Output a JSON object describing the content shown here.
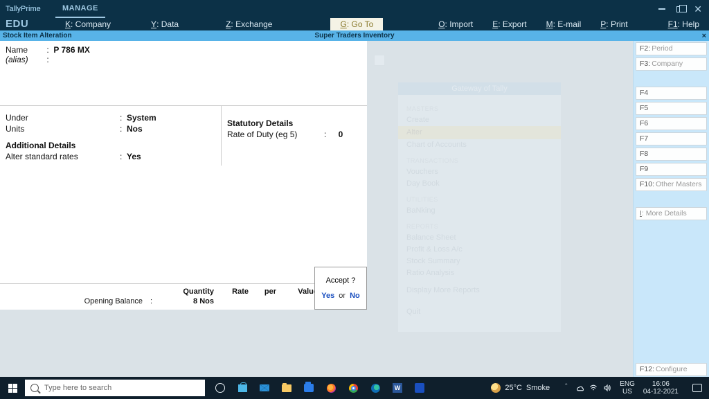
{
  "app": {
    "name": "TallyPrime",
    "edition": "EDU",
    "manage": "MANAGE"
  },
  "menu": {
    "company_key": "K",
    "company": ": Company",
    "data_key": "Y",
    "data": ": Data",
    "exchange_key": "Z",
    "exchange": ": Exchange",
    "goto_key": "G",
    "goto": ": Go To",
    "import_key": "O",
    "import": ": Import",
    "export_key": "E",
    "export": ": Export",
    "email_key": "M",
    "email": ": E-mail",
    "print_key": "P",
    "print": ": Print",
    "help_key": "F1",
    "help": ": Help"
  },
  "context": {
    "left": "Stock Item Alteration",
    "center": "Super Traders  Inventory"
  },
  "form": {
    "name_label": "Name",
    "name_value": "P 786 MX",
    "alias_label": "(alias)",
    "alias_value": "",
    "under_label": "Under",
    "under_value": "System",
    "units_label": "Units",
    "units_value": "Nos",
    "additional_title": "Additional Details",
    "alter_label": "Alter standard rates",
    "alter_value": "Yes",
    "statutory_title": "Statutory Details",
    "rate_label": "Rate of Duty (eg 5)",
    "rate_value": "0",
    "ob_header": {
      "qty": "Quantity",
      "rate": "Rate",
      "per": "per",
      "value": "Value"
    },
    "ob_label": "Opening Balance",
    "ob_qty": "8 Nos"
  },
  "accept": {
    "question": "Accept ?",
    "yes": "Yes",
    "or": "or",
    "no": "No"
  },
  "fkeys": {
    "f2k": "F2",
    "f2": "Period",
    "f3k": "F3",
    "f3": "Company",
    "f4": "F4",
    "f5": "F5",
    "f6": "F6",
    "f7": "F7",
    "f8": "F8",
    "f9": "F9",
    "f10k": "F10",
    "f10": "Other Masters",
    "morek": "I",
    "more": ": More Details",
    "f12k": "F12",
    "f12": "Configure"
  },
  "gateway": {
    "title": "Gateway of Tally",
    "cat_masters": "MASTERS",
    "create": "Create",
    "alter": "Alter",
    "coa": "Chart of Accounts",
    "cat_trans": "TRANSACTIONS",
    "vouch": "Vouchers",
    "daybook": "Day Book",
    "cat_util": "UTILITIES",
    "banking": "BaNking",
    "cat_rep": "REPORTS",
    "bs": "Balance Sheet",
    "pl": "Profit & Loss A/c",
    "ss": "Stock Summary",
    "ra": "Ratio Analysis",
    "dmr": "Display More Reports",
    "quit": "Quit"
  },
  "taskbar": {
    "search_placeholder": "Type here to search",
    "weather_temp": "25°C",
    "weather_desc": "Smoke",
    "lang1": "ENG",
    "lang2": "US",
    "time": "16:06",
    "date": "04-12-2021"
  }
}
